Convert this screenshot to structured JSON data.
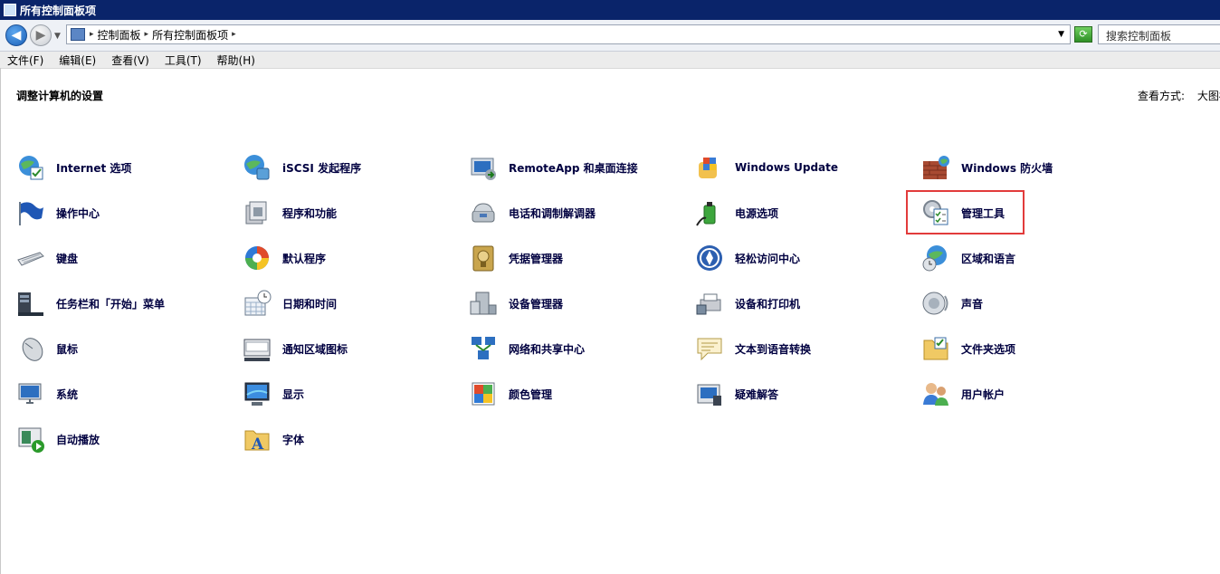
{
  "window": {
    "title": "所有控制面板项"
  },
  "address": {
    "crumbs": [
      "控制面板",
      "所有控制面板项"
    ],
    "search_placeholder": "搜索控制面板"
  },
  "menu": [
    "文件(F)",
    "编辑(E)",
    "查看(V)",
    "工具(T)",
    "帮助(H)"
  ],
  "main": {
    "heading": "调整计算机的设置",
    "view_by_label": "查看方式:",
    "view_by_value": "大图标"
  },
  "items": [
    {
      "label": "Internet 选项",
      "icon": "internet-options-icon"
    },
    {
      "label": "iSCSI 发起程序",
      "icon": "iscsi-initiator-icon"
    },
    {
      "label": "RemoteApp 和桌面连接",
      "icon": "remoteapp-icon"
    },
    {
      "label": "Windows Update",
      "icon": "windows-update-icon"
    },
    {
      "label": "Windows 防火墙",
      "icon": "firewall-icon"
    },
    {
      "label": "操作中心",
      "icon": "action-center-icon"
    },
    {
      "label": "程序和功能",
      "icon": "programs-features-icon"
    },
    {
      "label": "电话和调制解调器",
      "icon": "phone-modem-icon"
    },
    {
      "label": "电源选项",
      "icon": "power-options-icon"
    },
    {
      "label": "管理工具",
      "icon": "admin-tools-icon"
    },
    {
      "label": "键盘",
      "icon": "keyboard-icon"
    },
    {
      "label": "默认程序",
      "icon": "default-programs-icon"
    },
    {
      "label": "凭据管理器",
      "icon": "credential-manager-icon"
    },
    {
      "label": "轻松访问中心",
      "icon": "ease-of-access-icon"
    },
    {
      "label": "区域和语言",
      "icon": "region-language-icon"
    },
    {
      "label": "任务栏和「开始」菜单",
      "icon": "taskbar-start-icon"
    },
    {
      "label": "日期和时间",
      "icon": "date-time-icon"
    },
    {
      "label": "设备管理器",
      "icon": "device-manager-icon"
    },
    {
      "label": "设备和打印机",
      "icon": "devices-printers-icon"
    },
    {
      "label": "声音",
      "icon": "sound-icon"
    },
    {
      "label": "鼠标",
      "icon": "mouse-icon"
    },
    {
      "label": "通知区域图标",
      "icon": "notification-area-icon"
    },
    {
      "label": "网络和共享中心",
      "icon": "network-sharing-icon"
    },
    {
      "label": "文本到语音转换",
      "icon": "text-to-speech-icon"
    },
    {
      "label": "文件夹选项",
      "icon": "folder-options-icon"
    },
    {
      "label": "系统",
      "icon": "system-icon"
    },
    {
      "label": "显示",
      "icon": "display-icon"
    },
    {
      "label": "颜色管理",
      "icon": "color-management-icon"
    },
    {
      "label": "疑难解答",
      "icon": "troubleshooting-icon"
    },
    {
      "label": "用户帐户",
      "icon": "user-accounts-icon"
    },
    {
      "label": "自动播放",
      "icon": "autoplay-icon"
    },
    {
      "label": "字体",
      "icon": "fonts-icon"
    }
  ],
  "highlighted_item": "管理工具"
}
